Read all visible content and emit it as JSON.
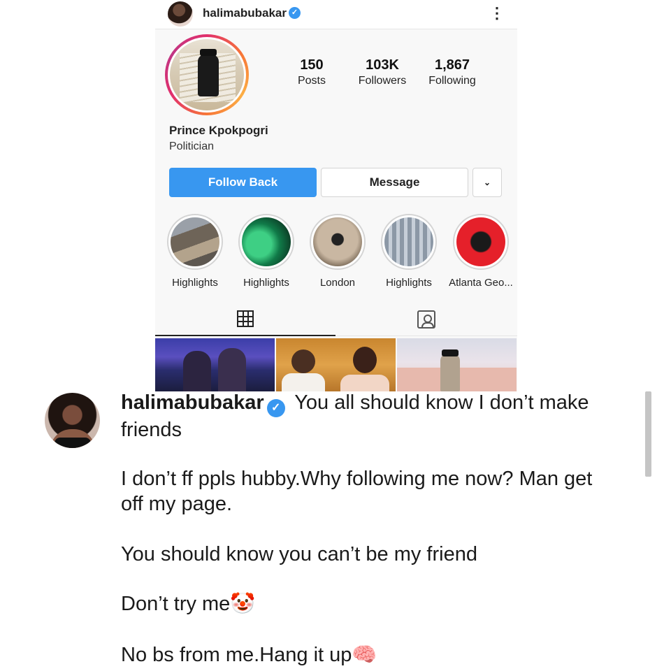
{
  "profile": {
    "header_username": "halimabubakar",
    "verified_mark": "✓",
    "menu_icon": "⋮",
    "stats": {
      "posts": {
        "value": "150",
        "label": "Posts"
      },
      "followers": {
        "value": "103K",
        "label": "Followers"
      },
      "following": {
        "value": "1,867",
        "label": "Following"
      }
    },
    "full_name": "Prince Kpokpogri",
    "bio": "Politician",
    "buttons": {
      "follow_back": "Follow Back",
      "message": "Message",
      "more": "⌄"
    },
    "highlights": [
      {
        "label": "Highlights"
      },
      {
        "label": "Highlights"
      },
      {
        "label": "London"
      },
      {
        "label": "Highlights"
      },
      {
        "label": "Atlanta Geo..."
      }
    ],
    "tabs": [
      "grid-icon",
      "tagged-icon"
    ],
    "accent_color": "#3897f0"
  },
  "caption": {
    "username": "halimabubakar",
    "verified_mark": "✓",
    "line_1": "You all should know I don’t make friends",
    "para_2": "I don’t ff ppls hubby.Why following me now? Man get off my page.",
    "para_3": "You should know you can’t be my friend",
    "para_4": "Don’t try me🤡",
    "para_5": "No bs from me.Hang it up🧠"
  }
}
